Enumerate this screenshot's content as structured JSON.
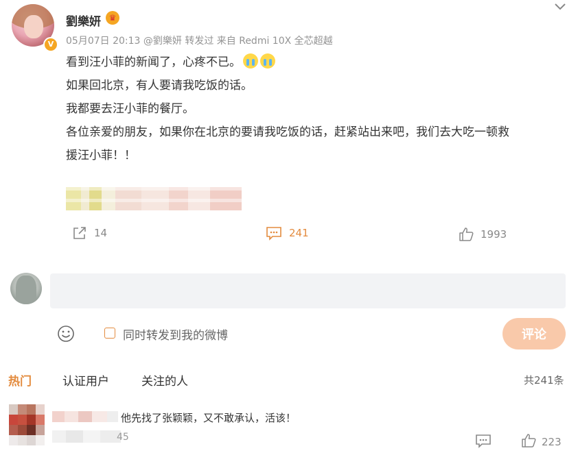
{
  "post": {
    "author": "劉樂妍",
    "verified_badge": "V",
    "crown_icon": "crown-icon",
    "meta": "05月07日 20:13 @劉樂妍 转发过  来自 Redmi 10X 全芯超越",
    "lines": [
      "看到汪小菲的新闻了，心疼不已。",
      "如果回北京，有人要请我吃饭的话。",
      "我都要去汪小菲的餐厅。",
      "各位亲爱的朋友，如果你在北京的要请我吃饭的话，赶紧站出来吧，我们去大吃一顿救",
      "援汪小菲！！"
    ],
    "emojis": [
      "crying-emoji",
      "crying-emoji"
    ]
  },
  "actions": {
    "repost_count": "14",
    "comment_count": "241",
    "like_count": "1993"
  },
  "composer": {
    "input_value": "",
    "repost_label": "同时转发到我的微博",
    "submit_label": "评论"
  },
  "tabs": {
    "items": [
      "热门",
      "认证用户",
      "关注的人"
    ],
    "total": "共241条"
  },
  "comment": {
    "text": "他先找了张颖颖，又不敢承认，活该！",
    "time_suffix": "45",
    "like_count": "223"
  },
  "colors": {
    "accent": "#e38b3e",
    "submit_bg": "#f9c9aa",
    "input_bg": "#f2f3f5"
  }
}
